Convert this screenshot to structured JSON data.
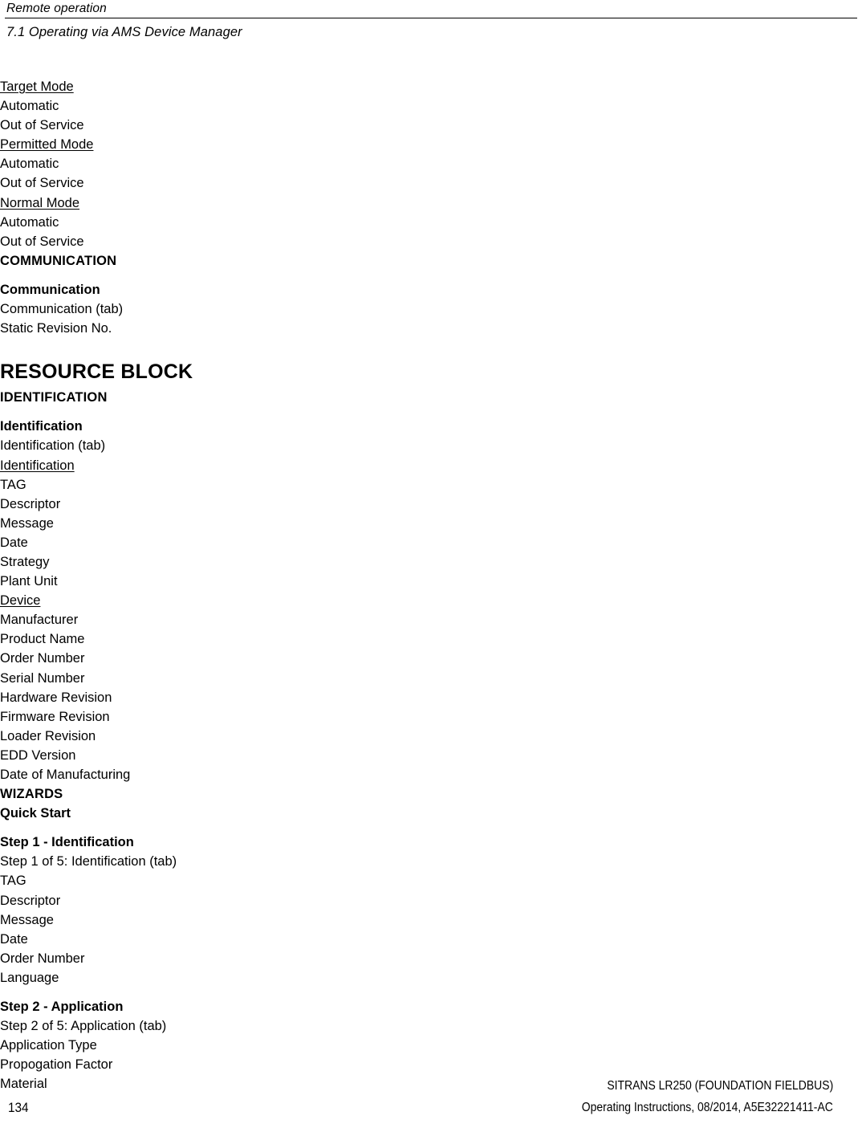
{
  "header": {
    "chapter": "Remote operation",
    "section": "7.1 Operating via AMS Device Manager"
  },
  "outline": {
    "mode_group": {
      "target_mode": "Target Mode",
      "target_mode_opt1": "Automatic",
      "target_mode_opt2": "Out of Service",
      "permitted_mode": "Permitted Mode",
      "permitted_mode_opt1": "Automatic",
      "permitted_mode_opt2": "Out of Service",
      "normal_mode": "Normal Mode",
      "normal_mode_opt1": "Automatic",
      "normal_mode_opt2": "Out of Service"
    },
    "communication": {
      "heading": "COMMUNICATION",
      "group": "Communication",
      "tab": "Communication (tab)",
      "item1": "Static Revision No."
    },
    "resource_block": {
      "heading": "RESOURCE BLOCK",
      "identification_heading": "IDENTIFICATION",
      "identification_group": "Identification",
      "identification_tab": "Identification (tab)",
      "identification_sub": "Identification",
      "identification_items": [
        "TAG",
        "Descriptor",
        "Message",
        "Date",
        "Strategy",
        "Plant Unit"
      ],
      "device_sub": "Device",
      "device_items": [
        "Manufacturer",
        "Product Name",
        "Order Number",
        "Serial Number",
        "Hardware Revision",
        "Firmware Revision",
        "Loader Revision",
        "EDD Version",
        "Date of Manufacturing"
      ]
    },
    "wizards": {
      "heading": "WIZARDS",
      "quick_start": "Quick Start",
      "step1_heading": "Step 1 - Identification",
      "step1_tab": "Step 1 of 5: Identification (tab)",
      "step1_items": [
        "TAG",
        "Descriptor",
        "Message",
        "Date",
        "Order Number",
        "Language"
      ],
      "step2_heading": "Step 2 - Application",
      "step2_tab": "Step 2 of 5: Application (tab)",
      "step2_items": [
        "Application Type",
        "Propogation Factor",
        "Material"
      ]
    }
  },
  "footer": {
    "product": "SITRANS LR250 (FOUNDATION FIELDBUS)",
    "document": "Operating Instructions, 08/2014, A5E32221411-AC",
    "page_number": "134"
  }
}
